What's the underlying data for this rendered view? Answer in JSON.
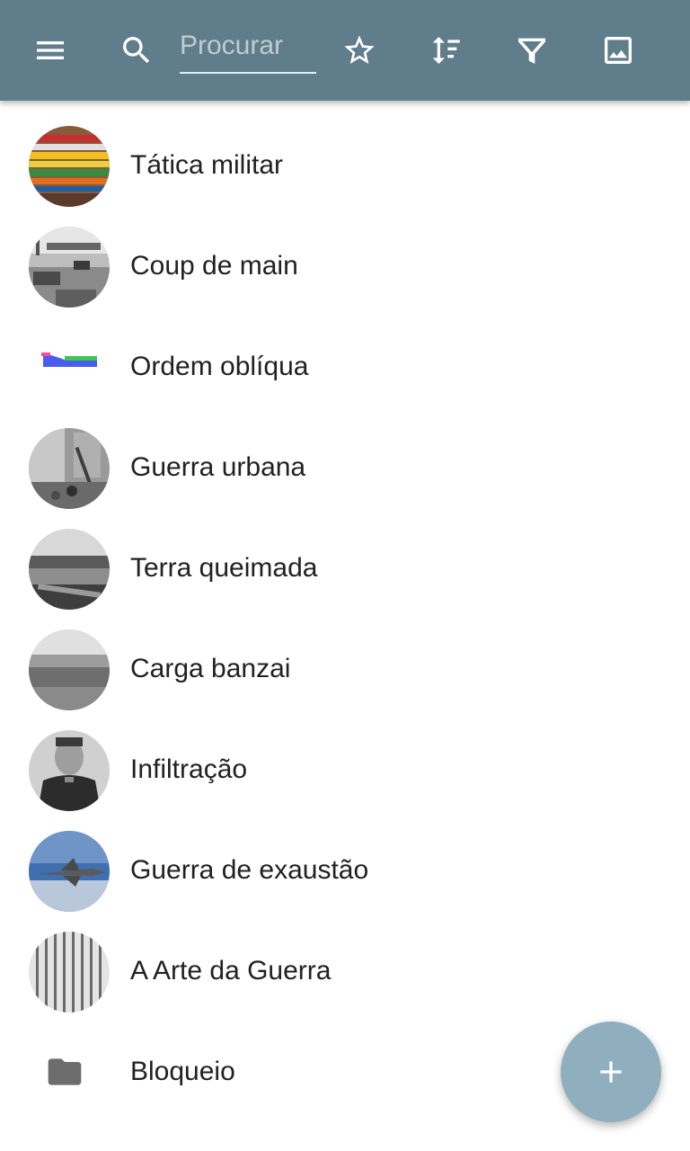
{
  "toolbar": {
    "search_placeholder": "Procurar",
    "search_value": "",
    "icons": [
      "menu-icon",
      "search-icon",
      "star-icon",
      "sort-icon",
      "filter-icon",
      "image-icon"
    ],
    "background_color": "#607d8b"
  },
  "items": [
    {
      "label": "Tática militar",
      "thumb": "thumbnail-colored-books"
    },
    {
      "label": "Coup de main",
      "thumb": "thumbnail-bw-bridge-photo"
    },
    {
      "label": "Ordem oblíqua",
      "thumb": "thumbnail-blue-green-diagram"
    },
    {
      "label": "Guerra urbana",
      "thumb": "thumbnail-bw-ruins-photo"
    },
    {
      "label": "Terra queimada",
      "thumb": "thumbnail-bw-crowd-photo"
    },
    {
      "label": "Carga banzai",
      "thumb": "thumbnail-bw-battlefield-photo"
    },
    {
      "label": "Infiltração",
      "thumb": "thumbnail-bw-soldier-portrait"
    },
    {
      "label": "Guerra de exaustão",
      "thumb": "thumbnail-jet-aircraft-photo"
    },
    {
      "label": "A Arte da Guerra",
      "thumb": "thumbnail-bamboo-text-photo"
    },
    {
      "label": "Bloqueio",
      "thumb": "folder-icon"
    }
  ],
  "fab": {
    "icon": "plus-icon",
    "color": "#8fafbf"
  }
}
